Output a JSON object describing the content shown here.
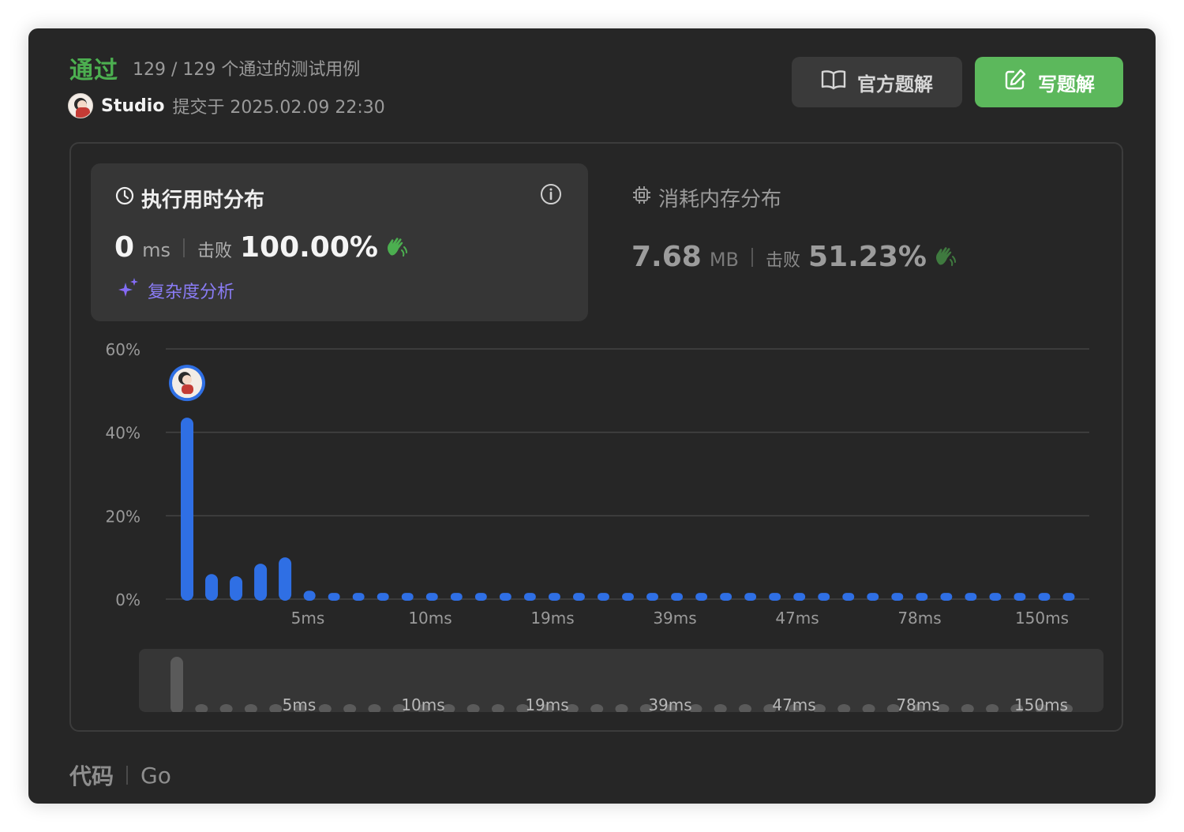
{
  "header": {
    "status": "通过",
    "cases_text": "129 / 129 个通过的测试用例",
    "user_name": "Studio",
    "submitted_text": "提交于 2025.02.09 22:30"
  },
  "buttons": {
    "official_solution": "官方题解",
    "write_solution": "写题解"
  },
  "runtime": {
    "title": "执行用时分布",
    "value": "0",
    "unit": "ms",
    "beat_label": "击败",
    "beat_value": "100.00%",
    "analysis_link": "复杂度分析"
  },
  "memory": {
    "title": "消耗内存分布",
    "value": "7.68",
    "unit": "MB",
    "beat_label": "击败",
    "beat_value": "51.23%"
  },
  "code": {
    "label": "代码",
    "language": "Go"
  },
  "colors": {
    "pass_green": "#4caf50",
    "write_button": "#5cb85c",
    "bar_blue": "#2f6fe4",
    "analysis_purple": "#8a7cf5"
  },
  "chart_data": {
    "type": "bar",
    "title": "执行用时分布",
    "y_ticks": [
      "60%",
      "40%",
      "20%",
      "0%"
    ],
    "ylim": [
      0,
      60
    ],
    "x_tick_labels": [
      "5ms",
      "10ms",
      "19ms",
      "39ms",
      "47ms",
      "78ms",
      "150ms"
    ],
    "values": [
      43.5,
      6,
      5.5,
      8.5,
      10,
      2,
      1.5,
      1.5,
      1.5,
      1.5,
      1.5,
      1.5,
      1.5,
      1.5,
      1.5,
      1.5,
      1.5,
      1.5,
      1.5,
      1.5,
      1.5,
      1.5,
      1.5,
      1.5,
      1.5,
      1.5,
      1.5,
      1.5,
      1.5,
      1.5,
      1.5,
      1.5,
      1.5,
      1.5,
      1.5,
      1.5,
      1.5
    ],
    "current_bar_index": 0,
    "grid": true
  }
}
